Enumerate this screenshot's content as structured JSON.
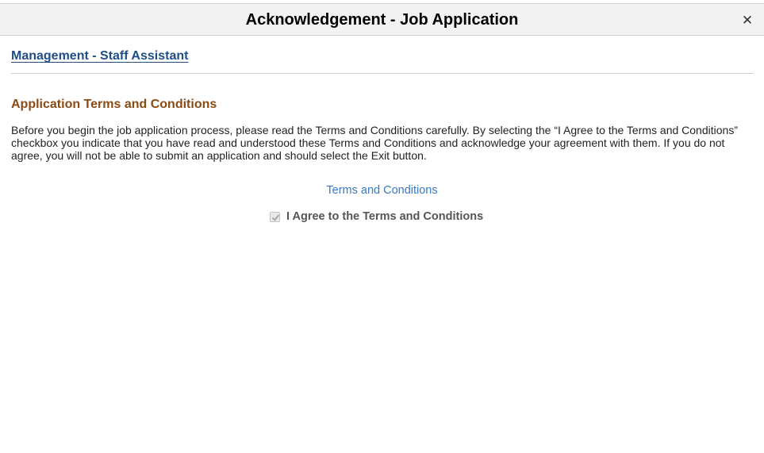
{
  "dialog": {
    "title": "Acknowledgement - Job Application",
    "close_glyph": "✕",
    "close_icon": "close-icon"
  },
  "job": {
    "title": "Management - Staff Assistant"
  },
  "terms": {
    "heading": "Application Terms and Conditions",
    "body": "Before you begin the job application process, please read the Terms and Conditions carefully. By selecting the “I Agree to the Terms and Conditions” checkbox you indicate that you have read and understood these Terms and Conditions and acknowledge your agreement with them. If you do not agree, you will not be able to submit an application and should select the Exit button.",
    "link_label": "Terms and Conditions",
    "agree_label": "I Agree to the Terms and Conditions",
    "agree_checked": true,
    "agree_disabled": true
  },
  "colors": {
    "header_bg": "#f2f2f2",
    "job_link": "#1f4e87",
    "section_heading": "#8a4a14",
    "terms_link": "#3a78bf"
  }
}
